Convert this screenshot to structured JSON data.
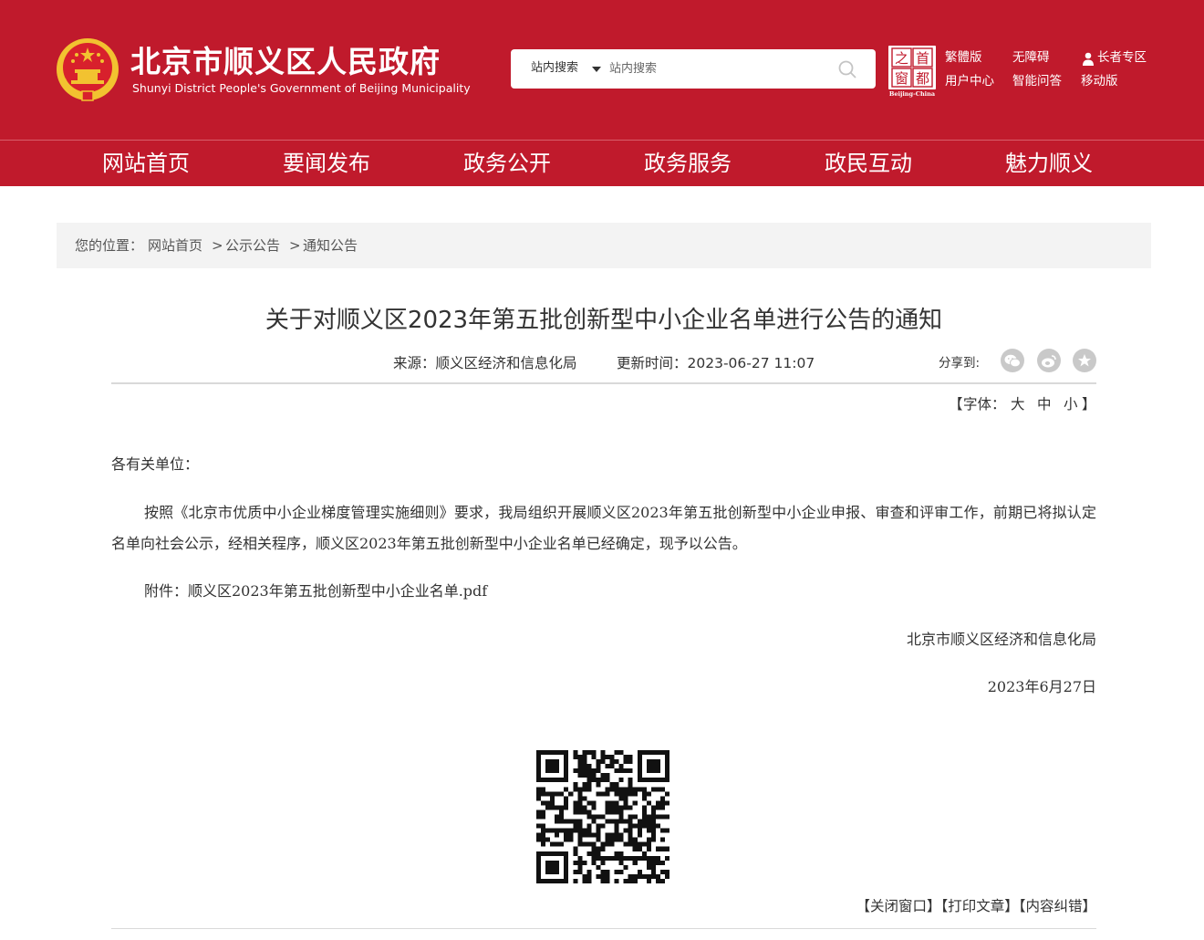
{
  "header": {
    "site_title": "北京市顺义区人民政府",
    "site_subtitle": "Shunyi District People's Government of Beijing Municipality",
    "search": {
      "scope_label": "站内搜索",
      "placeholder": "站内搜索"
    },
    "capital_logo": {
      "chars": [
        "之",
        "首",
        "窗",
        "都"
      ],
      "caption": "Beijing-China"
    },
    "quick_links": {
      "traditional": "繁體版",
      "accessible": "无障碍",
      "elderly": "长者专区",
      "user_center": "用户中心",
      "smart_qa": "智能问答",
      "mobile": "移动版"
    },
    "colors": {
      "brand_red": "#c01a2c",
      "emblem_gold": "#f2c230"
    }
  },
  "nav": {
    "items": [
      {
        "label": "网站首页"
      },
      {
        "label": "要闻发布"
      },
      {
        "label": "政务公开"
      },
      {
        "label": "政务服务"
      },
      {
        "label": "政民互动"
      },
      {
        "label": "魅力顺义"
      }
    ]
  },
  "breadcrumb": {
    "prefix": "您的位置：",
    "items": [
      "网站首页",
      "公示公告",
      "通知公告"
    ],
    "separator": ">"
  },
  "article": {
    "title": "关于对顺义区2023年第五批创新型中小企业名单进行公告的通知",
    "source": "来源：顺义区经济和信息化局",
    "updated": "更新时间：2023-06-27 11:07",
    "share_label": "分享到:",
    "font_size": {
      "open": "【",
      "label": "字体：",
      "large": "大",
      "medium": "中",
      "small": "小",
      "close": "】"
    },
    "salutation": "各有关单位：",
    "paragraph": "按照《北京市优质中小企业梯度管理实施细则》要求，我局组织开展顺义区2023年第五批创新型中小企业申报、审查和评审工作，前期已将拟认定名单向社会公示，经相关程序，顺义区2023年第五批创新型中小企业名单已经确定，现予以公告。",
    "attachment": "附件：顺义区2023年第五批创新型中小企业名单.pdf",
    "signature": "北京市顺义区经济和信息化局",
    "date": "2023年6月27日"
  },
  "footer_actions": {
    "close_window": "【关闭窗口】",
    "print_article": "【打印文章】",
    "report_error": "【内容纠错】"
  }
}
